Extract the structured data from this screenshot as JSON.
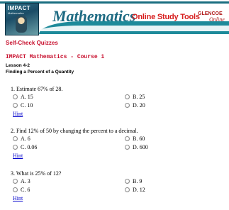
{
  "header": {
    "book_title": "IMPACT",
    "book_subtitle": "Mathematics",
    "app_title": "Mathematics",
    "subtitle": "Online Study Tools",
    "logo_brand": "GLENCOE",
    "logo_online": "Online"
  },
  "page": {
    "section_title": "Self-Check Quizzes",
    "course": "IMPACT Mathematics - Course 1",
    "lesson": "Lesson 4-2",
    "topic": "Finding a Percent of a Quantity"
  },
  "questions": [
    {
      "text": "1.  Estimate 67% of 28.",
      "options": [
        "A.  15",
        "B.  25",
        "C.  10",
        "D.  20"
      ],
      "hint": "Hint"
    },
    {
      "text": "2.  Find 12% of 50 by changing the percent to a decimal.",
      "options": [
        "A.  6",
        "B.  60",
        "C.  0.06",
        "D.  600"
      ],
      "hint": "Hint"
    },
    {
      "text": "3.  What is 25% of 12?",
      "options": [
        "A.  3",
        "B.  9",
        "C.  6",
        "D.  12"
      ],
      "hint": "Hint"
    }
  ],
  "colors": {
    "accent_red": "#c8102e",
    "teal": "#1d6a82",
    "link": "#0000cc"
  }
}
